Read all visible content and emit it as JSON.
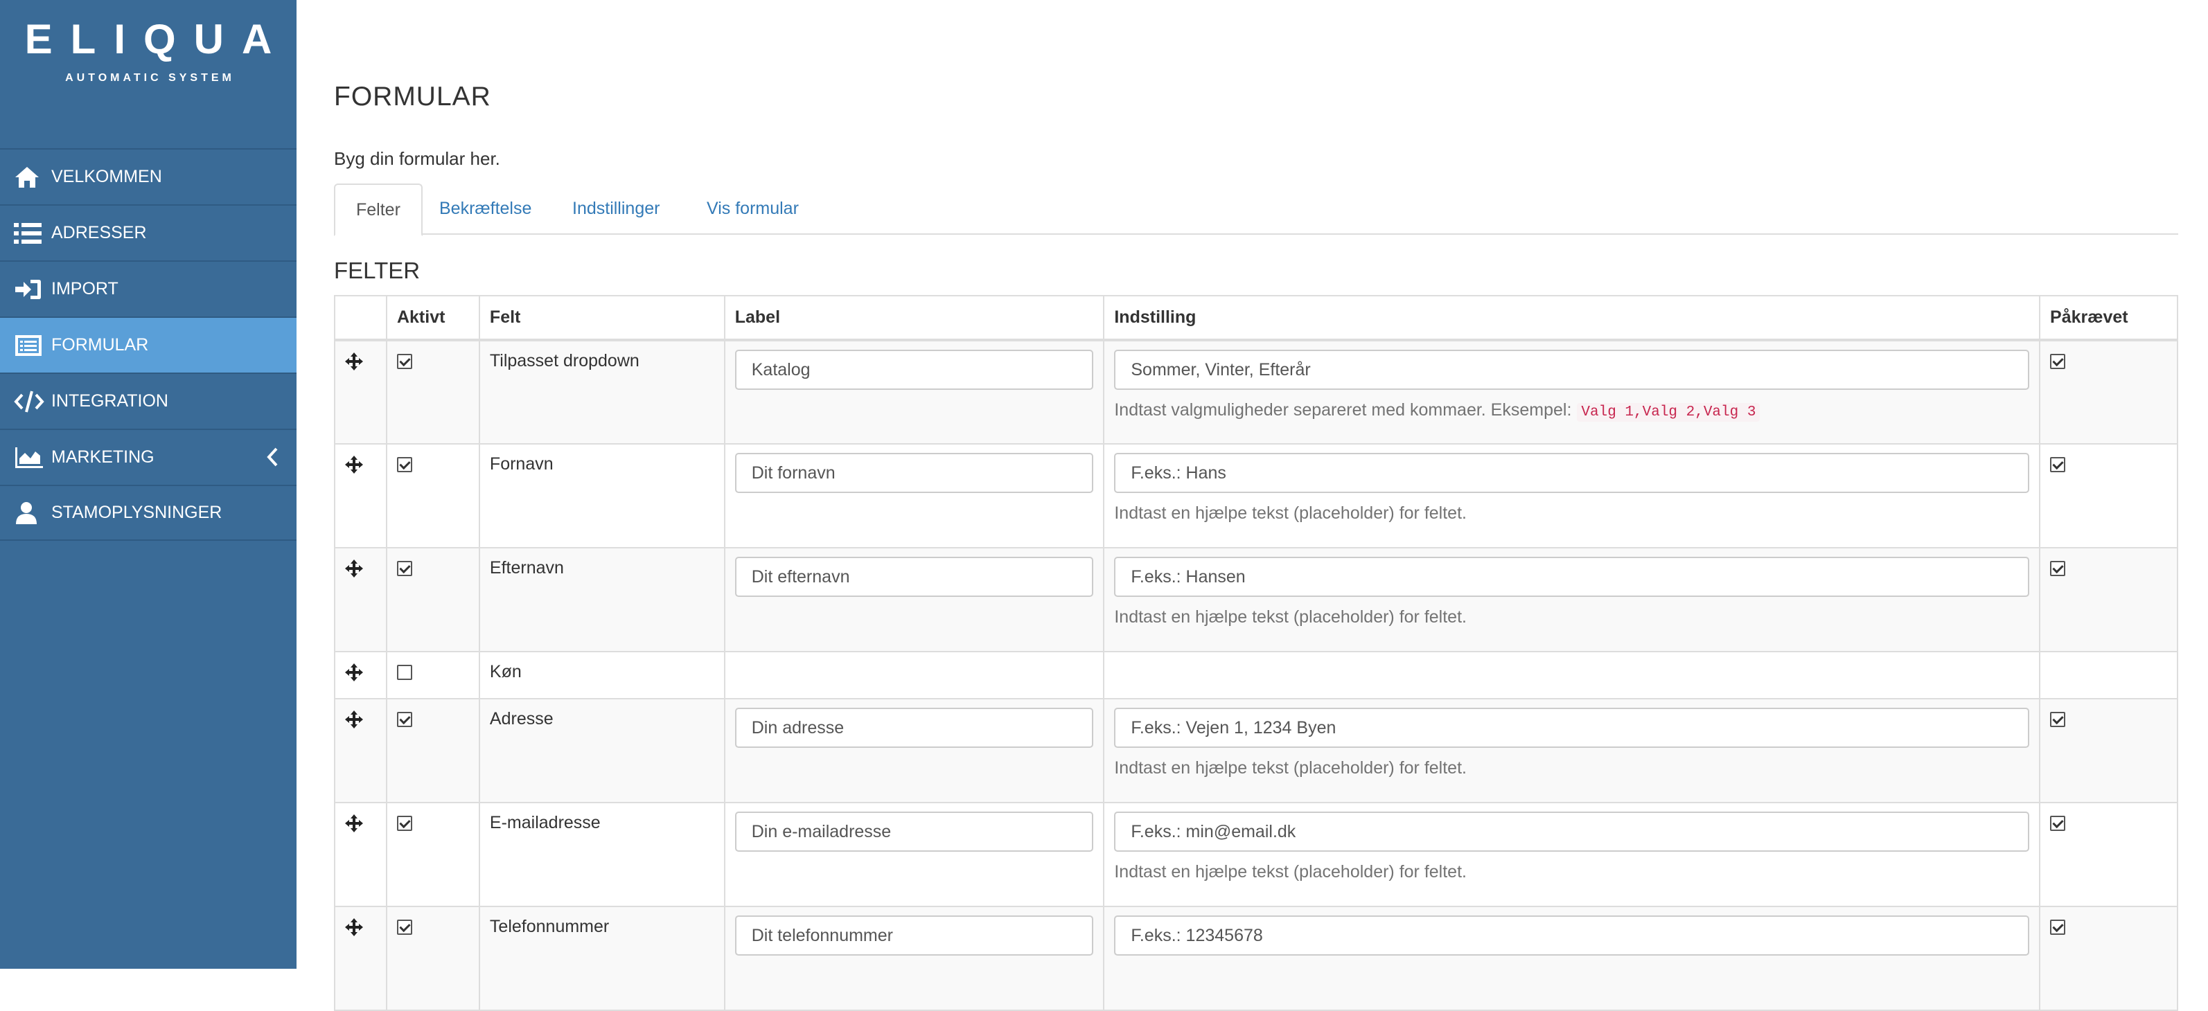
{
  "logo": {
    "word": "ELIQUA",
    "sub": "AUTOMATIC SYSTEM"
  },
  "nav": {
    "items": [
      {
        "label": "VELKOMMEN",
        "icon": "home-icon"
      },
      {
        "label": "ADRESSER",
        "icon": "list-icon"
      },
      {
        "label": "IMPORT",
        "icon": "sign-in-icon"
      },
      {
        "label": "FORMULAR",
        "icon": "form-list-icon",
        "active": true
      },
      {
        "label": "INTEGRATION",
        "icon": "code-icon"
      },
      {
        "label": "MARKETING",
        "icon": "area-chart-icon"
      },
      {
        "label": "STAMOPLYSNINGER",
        "icon": "user-icon"
      }
    ]
  },
  "page": {
    "title": "FORMULAR",
    "description": "Byg din formular her.",
    "tabs": [
      "Felter",
      "Bekræftelse",
      "Indstillinger",
      "Vis formular"
    ],
    "section_title": "FELTER"
  },
  "table": {
    "headers": [
      "",
      "Aktivt",
      "Felt",
      "Label",
      "Indstilling",
      "Påkrævet"
    ],
    "rows": [
      {
        "active": true,
        "felt": "Tilpasset dropdown",
        "label": "Katalog",
        "setting": "Sommer, Vinter, Efterår",
        "help": "Indtast valgmuligheder separeret med kommaer. Eksempel:",
        "help_code": "Valg 1,Valg 2,Valg 3",
        "required": true
      },
      {
        "active": true,
        "felt": "Fornavn",
        "label": "Dit fornavn",
        "setting": "F.eks.: Hans",
        "help": "Indtast en hjælpe tekst (placeholder) for feltet.",
        "required": true
      },
      {
        "active": true,
        "felt": "Efternavn",
        "label": "Dit efternavn",
        "setting": "F.eks.: Hansen",
        "help": "Indtast en hjælpe tekst (placeholder) for feltet.",
        "required": true
      },
      {
        "active": false,
        "felt": "Køn"
      },
      {
        "active": true,
        "felt": "Adresse",
        "label": "Din adresse",
        "setting": "F.eks.: Vejen 1, 1234 Byen",
        "help": "Indtast en hjælpe tekst (placeholder) for feltet.",
        "required": true
      },
      {
        "active": true,
        "felt": "E-mailadresse",
        "label": "Din e-mailadresse",
        "setting": "F.eks.: min@email.dk",
        "help": "Indtast en hjælpe tekst (placeholder) for feltet.",
        "required": true
      },
      {
        "active": true,
        "felt": "Telefonnummer",
        "label": "Dit telefonnummer",
        "setting": "F.eks.: 12345678",
        "help": "",
        "required": true
      }
    ]
  },
  "colors": {
    "sidebar": "#3a6b97",
    "active_nav": "#5a9fd8",
    "link": "#337ab7"
  }
}
